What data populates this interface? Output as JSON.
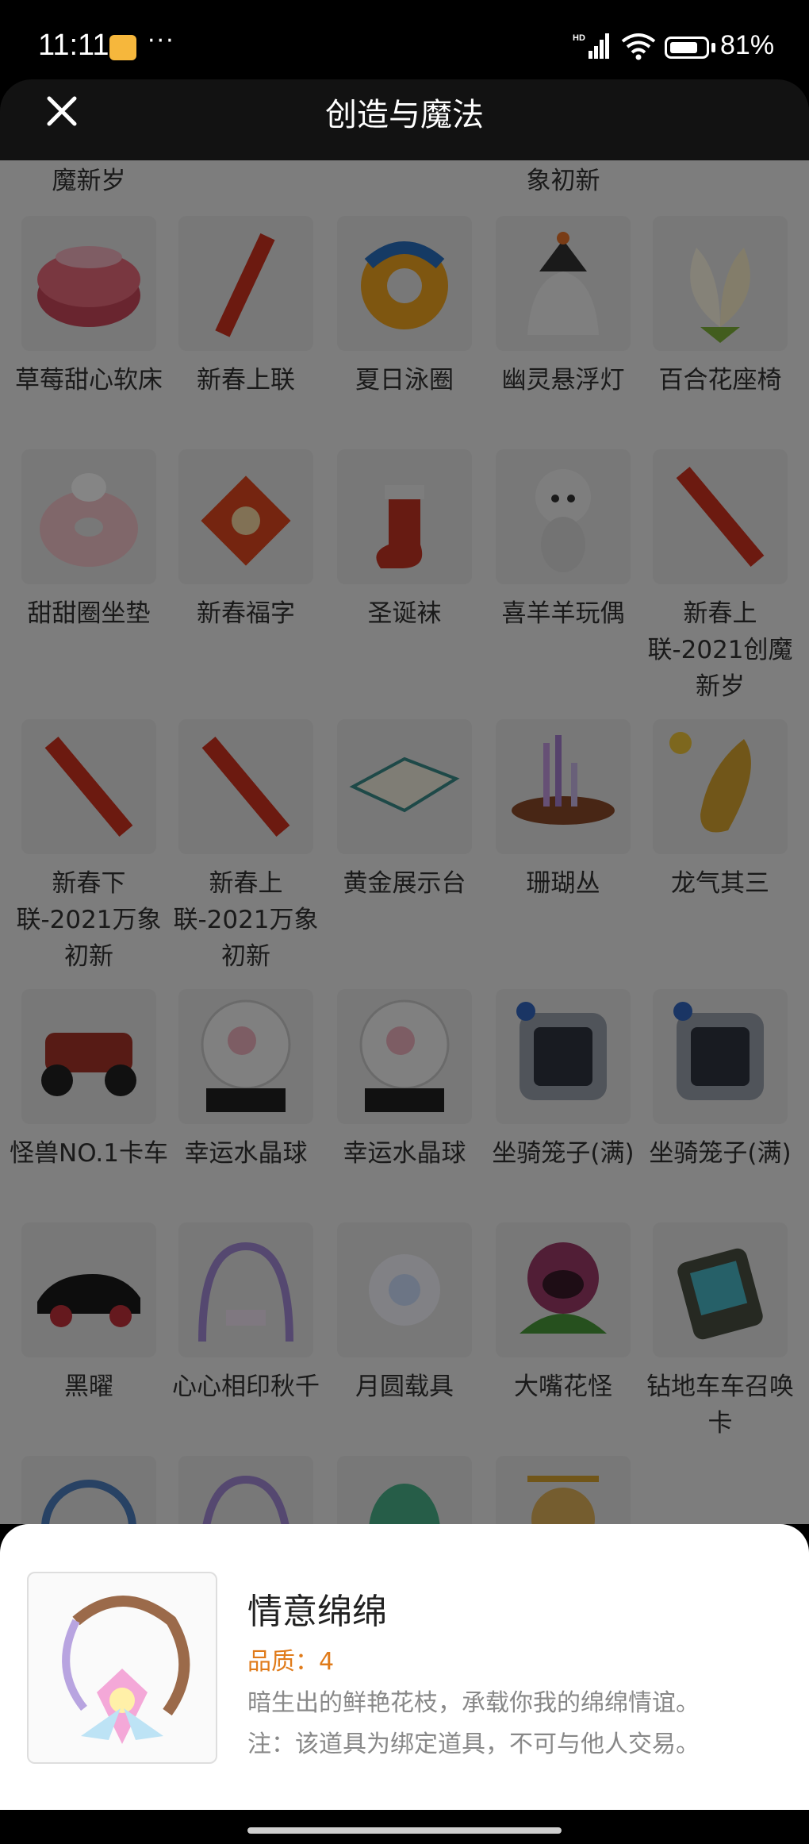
{
  "status_bar": {
    "time": "11:11",
    "dots": "···",
    "hd": "HD",
    "battery_pct": "81%",
    "battery_level": 0.81
  },
  "header": {
    "title": "创造与魔法"
  },
  "top_partial": {
    "left": "魔新岁",
    "right": "象初新"
  },
  "grid": [
    {
      "label": "草莓甜心软床",
      "icon": "bed-icon"
    },
    {
      "label": "新春上联",
      "icon": "couplet-icon"
    },
    {
      "label": "夏日泳圈",
      "icon": "swim-ring-icon"
    },
    {
      "label": "幽灵悬浮灯",
      "icon": "ghost-lamp-icon"
    },
    {
      "label": "百合花座椅",
      "icon": "lily-chair-icon"
    },
    {
      "label": "甜甜圈坐垫",
      "icon": "donut-cushion-icon"
    },
    {
      "label": "新春福字",
      "icon": "fu-character-icon"
    },
    {
      "label": "圣诞袜",
      "icon": "christmas-sock-icon"
    },
    {
      "label": "喜羊羊玩偶",
      "icon": "sheep-doll-icon"
    },
    {
      "label": "新春上联-2021创魔新岁",
      "icon": "couplet-icon"
    },
    {
      "label": "新春下联-2021万象初新",
      "icon": "couplet-icon"
    },
    {
      "label": "新春上联-2021万象初新",
      "icon": "couplet-icon"
    },
    {
      "label": "黄金展示台",
      "icon": "display-stand-icon"
    },
    {
      "label": "珊瑚丛",
      "icon": "coral-icon"
    },
    {
      "label": "龙气其三",
      "icon": "dragon-relic-icon"
    },
    {
      "label": "怪兽NO.1卡车",
      "icon": "monster-truck-icon"
    },
    {
      "label": "幸运水晶球",
      "icon": "crystal-ball-icon"
    },
    {
      "label": "幸运水晶球",
      "icon": "crystal-ball-icon"
    },
    {
      "label": "坐骑笼子(满)",
      "icon": "mount-cage-icon"
    },
    {
      "label": "坐骑笼子(满)",
      "icon": "mount-cage-icon"
    },
    {
      "label": "黑曜",
      "icon": "car-icon"
    },
    {
      "label": "心心相印秋千",
      "icon": "swing-icon"
    },
    {
      "label": "月圆载具",
      "icon": "moon-vehicle-icon"
    },
    {
      "label": "大嘴花怪",
      "icon": "plant-monster-icon"
    },
    {
      "label": "钻地车车召唤卡",
      "icon": "summon-card-icon"
    },
    {
      "label": "",
      "icon": "wreath-icon"
    },
    {
      "label": "",
      "icon": "swing-icon"
    },
    {
      "label": "",
      "icon": "egg-icon"
    },
    {
      "label": "",
      "icon": "helicopter-icon"
    }
  ],
  "detail": {
    "name": "情意绵绵",
    "quality": "品质：4",
    "desc1": "暗生出的鲜艳花枝，承载你我的绵绵情谊。",
    "desc2": "注：该道具为绑定道具，不可与他人交易。",
    "icon": "floral-wreath-icon"
  }
}
